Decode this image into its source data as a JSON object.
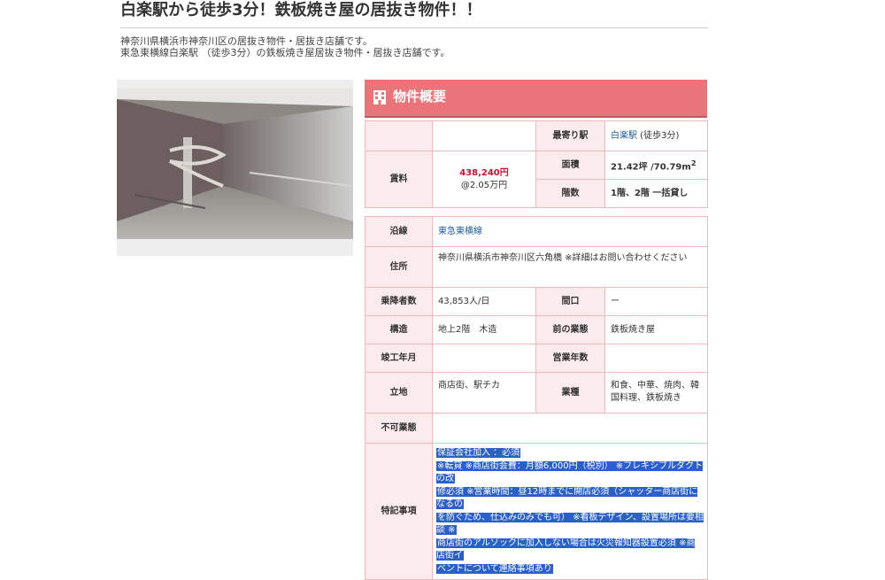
{
  "page": {
    "title": "白楽駅から徒歩3分！鉄板焼き屋の居抜き物件！！",
    "description_lines": [
      "神奈川県横浜市神奈川区の居抜き物件・居抜き店舗です。",
      "東急東横線白楽駅 （徒歩3分）の鉄板焼き屋居抜き物件・居抜き店舗です。"
    ]
  },
  "overview": {
    "heading": "物件概要",
    "rent_label": "賃料",
    "rent_value": "438,240円",
    "rent_unit_price": "@2.05万円",
    "nearest_station_label": "最寄り駅",
    "nearest_station_link": "白楽駅",
    "nearest_station_walk": " (徒歩3分)",
    "area_label": "面積",
    "area_value": "21.42坪 /70.79m",
    "area_sup": "2",
    "floors_label": "階数",
    "floors_value": "1階、2階 一括貸し"
  },
  "details": {
    "line_label": "沿線",
    "line_value": "東急東横線",
    "address_label": "住所",
    "address_value": "神奈川県横浜市神奈川区六角橋 ※詳細はお問い合わせください",
    "passengers_label": "乗降者数",
    "passengers_value": "43,853人/日",
    "frontage_label": "間口",
    "frontage_value": "ー",
    "structure_label": "構造",
    "structure_value": "地上2階　木造",
    "prev_business_label": "前の業態",
    "prev_business_value": "鉄板焼き屋",
    "built_label": "竣工年月",
    "built_value": "",
    "years_label": "営業年数",
    "years_value": "",
    "location_label": "立地",
    "location_value": "商店街、駅チカ",
    "category_label": "業種",
    "category_value": "和食、中華、焼肉、韓国料理、鉄板焼き",
    "unavailable_label": "不可業態",
    "unavailable_value": "",
    "notes_label": "特記事項",
    "notes_lines": [
      "保証会社加入 ：必須",
      "※転貸 ※商店街会費：月額6,000円（税別） ※フレキシブルダクトの改",
      "修必須 ※営業時間：昼12時までに開店必須（シャッター商店街になるの",
      "を防ぐため、仕込みのみでも可） ※看板デザイン、設置場所は要相談 ※",
      "商店街のアルソックに加入しない場合は火災報知器設置必須 ※商店街イ",
      "ベントについて連絡事項あり"
    ]
  },
  "icons": {
    "heading_icon": "building-icon"
  },
  "colors": {
    "accent": "#e9747a",
    "label_bg": "#fcebec",
    "border": "#f2b7ba",
    "price": "#c8102e",
    "link": "#1f5c99",
    "selection": "#2b5fc9"
  }
}
